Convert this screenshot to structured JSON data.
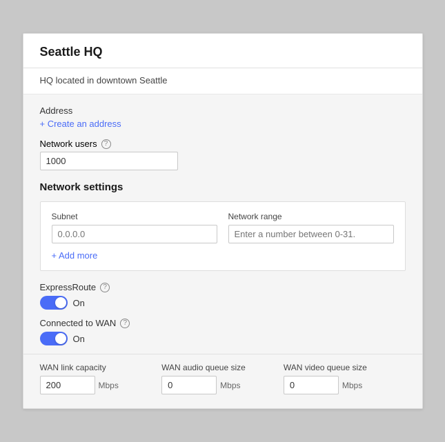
{
  "card": {
    "title": "Seattle HQ",
    "subtitle": "HQ located in downtown Seattle"
  },
  "address": {
    "label": "Address",
    "create_link": "+ Create an address"
  },
  "network_users": {
    "label": "Network users",
    "value": "1000"
  },
  "network_settings": {
    "section_title": "Network settings",
    "subnet_label": "Subnet",
    "subnet_placeholder": "0.0.0.0",
    "network_range_label": "Network range",
    "network_range_placeholder": "Enter a number between 0-31.",
    "add_more_label": "+ Add more"
  },
  "express_route": {
    "label": "ExpressRoute",
    "on_label": "On",
    "checked": true
  },
  "connected_to_wan": {
    "label": "Connected to WAN",
    "on_label": "On",
    "checked": true
  },
  "wan_link_capacity": {
    "label": "WAN link capacity",
    "value": "200",
    "unit": "Mbps"
  },
  "wan_audio_queue_size": {
    "label": "WAN audio queue size",
    "value": "0",
    "unit": "Mbps"
  },
  "wan_video_queue_size": {
    "label": "WAN video queue size",
    "value": "0",
    "unit": "Mbps"
  },
  "icons": {
    "help": "?",
    "plus": "+"
  }
}
